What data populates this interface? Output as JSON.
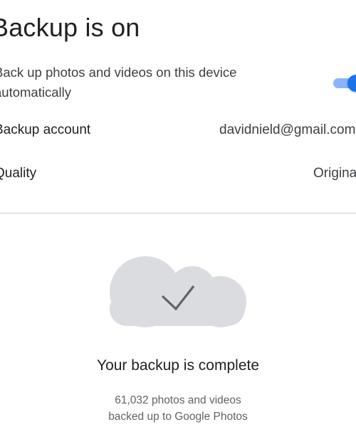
{
  "header": {
    "title": "Backup is on"
  },
  "backup_toggle": {
    "label": "Back up photos and videos on this device automatically",
    "state": "on",
    "accent_color": "#1a73e8"
  },
  "settings": {
    "account_label": "Backup account",
    "account_value": "davidnield@gmail.com",
    "quality_label": "Quality",
    "quality_value": "Original"
  },
  "status": {
    "icon": "cloud-check-icon",
    "title": "Your backup is complete",
    "detail_line1": "61,032 photos and videos",
    "detail_line2": "backed up to Google Photos"
  }
}
